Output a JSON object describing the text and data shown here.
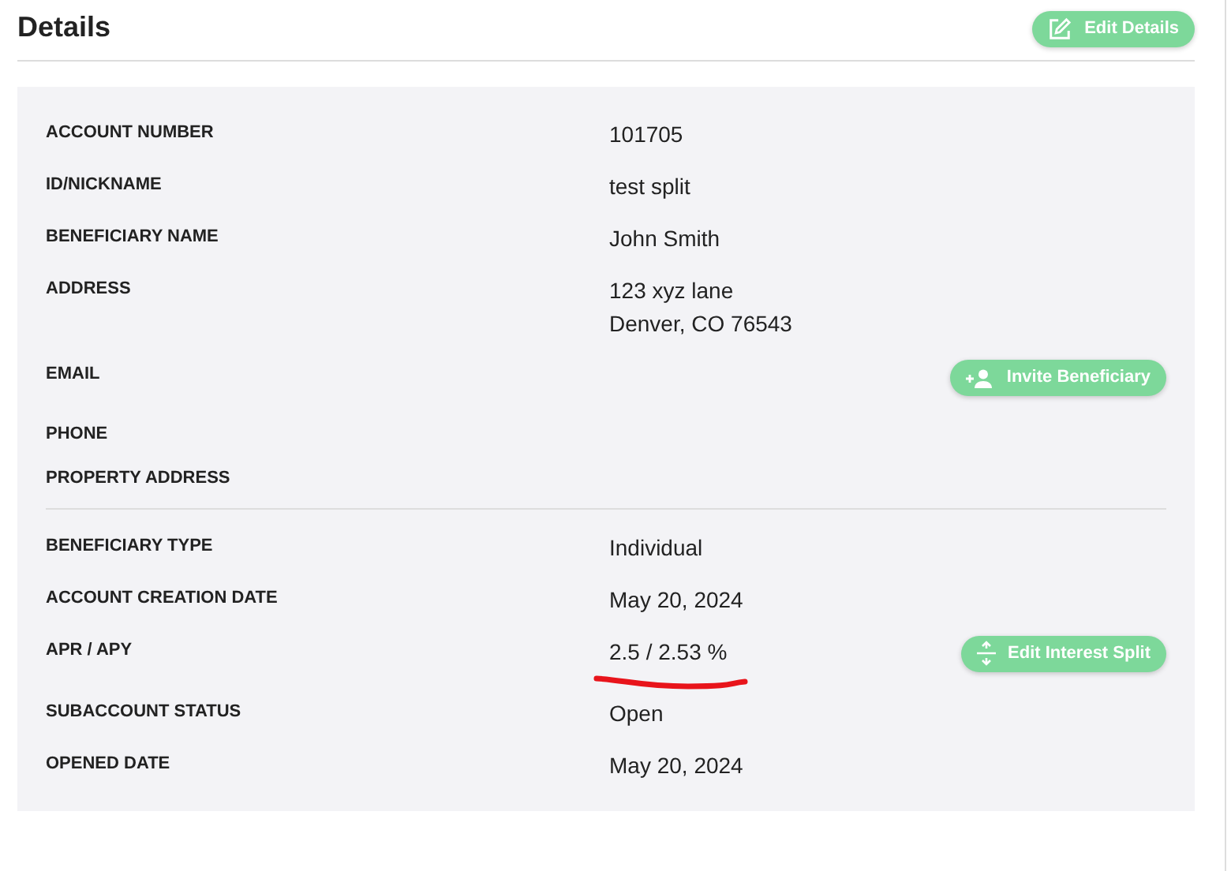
{
  "header": {
    "title": "Details",
    "button": "Edit Details"
  },
  "sections": [
    {
      "rows": [
        {
          "label": "ACCOUNT NUMBER",
          "value": [
            "101705"
          ]
        },
        {
          "label": "ID/NICKNAME",
          "value": [
            "test split"
          ]
        },
        {
          "label": "BENEFICIARY NAME",
          "value": [
            "John Smith"
          ]
        },
        {
          "label": "ADDRESS",
          "value": [
            "123 xyz lane",
            "Denver, CO 76543"
          ]
        },
        {
          "label": "EMAIL",
          "value": [],
          "action": {
            "kind": "invite",
            "label": "Invite Beneficiary"
          }
        },
        {
          "label": "PHONE",
          "value": []
        },
        {
          "label": "PROPERTY ADDRESS",
          "value": []
        }
      ]
    },
    {
      "rows": [
        {
          "label": "BENEFICIARY TYPE",
          "value": [
            "Individual"
          ]
        },
        {
          "label": "ACCOUNT CREATION DATE",
          "value": [
            "May 20, 2024"
          ]
        },
        {
          "label": "APR / APY",
          "value": [
            "2.5 / 2.53 %"
          ],
          "annotated": true,
          "action": {
            "kind": "split",
            "label": "Edit Interest Split"
          }
        },
        {
          "label": "SUBACCOUNT STATUS",
          "value": [
            "Open"
          ]
        },
        {
          "label": "OPENED DATE",
          "value": [
            "May 20, 2024"
          ]
        }
      ]
    }
  ]
}
